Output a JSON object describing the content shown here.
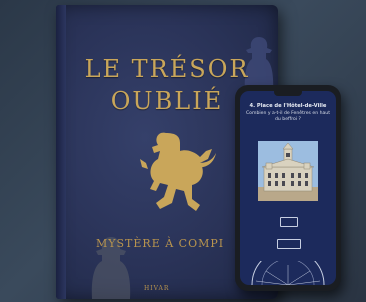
{
  "book": {
    "title_line1": "LE TRÉSOR",
    "title_line2": "OUBLIÉ",
    "subtitle": "MYSTÈRE À COMPI",
    "brand": "HIVAR",
    "colors": {
      "cover": "#2a3358",
      "gold": "#c9a65a"
    }
  },
  "phone": {
    "question_title": "4. Place de l'Hôtel-de-Ville",
    "question_text": "Combien y a-t-il de Fenêtres en haut du beffroi ?",
    "answer_field_icon": "input-box",
    "submit_icon": "submit-button",
    "colors": {
      "screen": "#1c2a5c",
      "text": "#e8ecf4"
    }
  }
}
